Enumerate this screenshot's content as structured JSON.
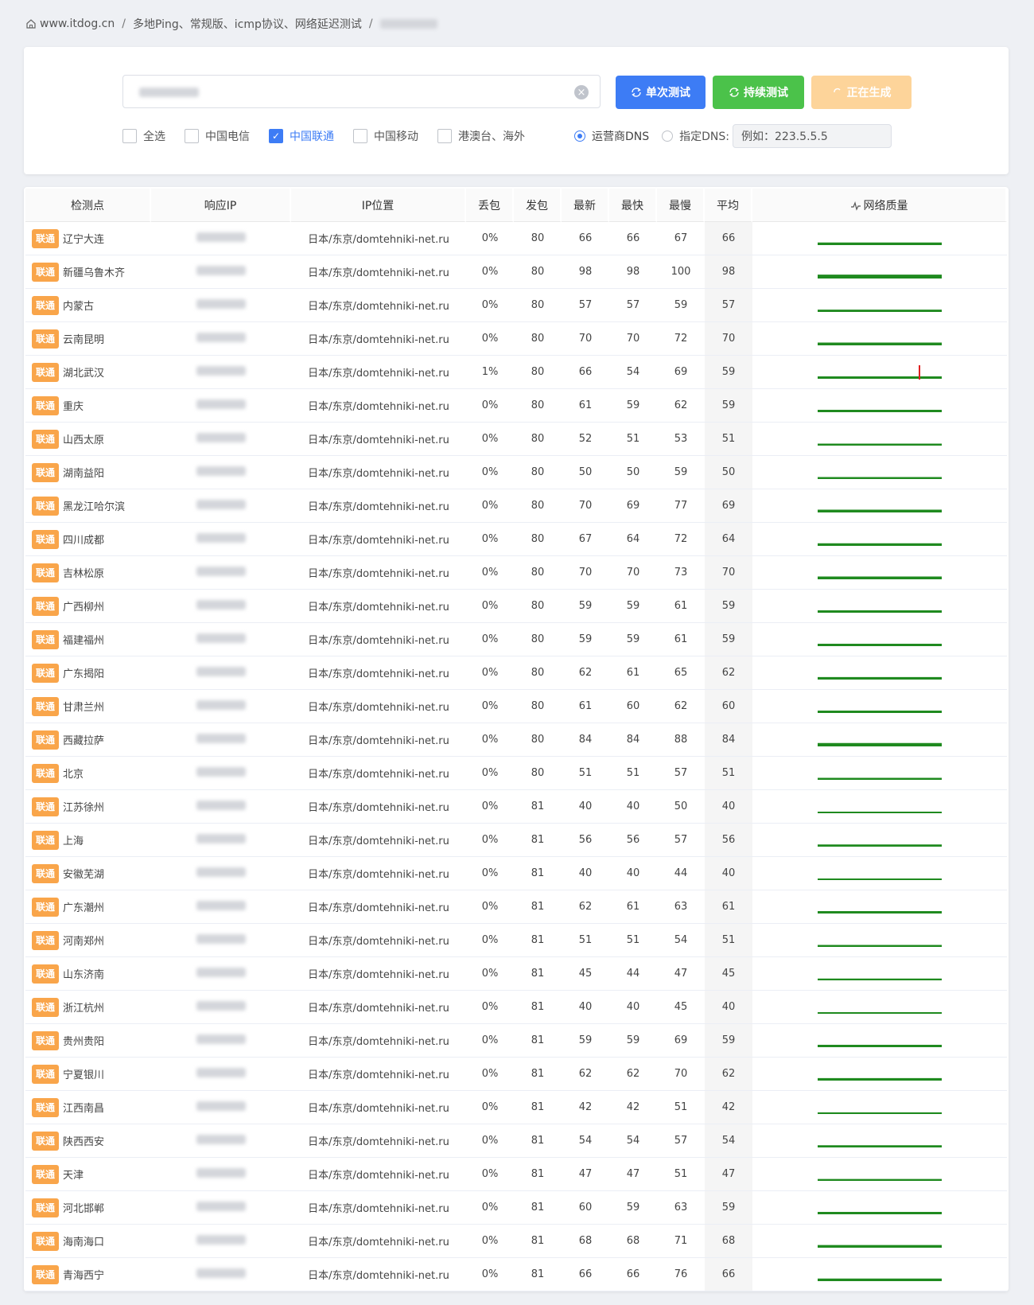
{
  "breadcrumb": {
    "home": "www.itdog.cn",
    "page": "多地Ping、常规版、icmp协议、网络延迟测试"
  },
  "search": {
    "placeholder": ""
  },
  "buttons": {
    "single": "单次测试",
    "continuous": "持续测试",
    "generating": "正在生成"
  },
  "options": {
    "select_all": "全选",
    "telecom": "中国电信",
    "unicom": "中国联通",
    "mobile": "中国移动",
    "overseas": "港澳台、海外",
    "isp_dns": "运营商DNS",
    "custom_dns": "指定DNS:",
    "dns_placeholder": "例如：223.5.5.5"
  },
  "table": {
    "headers": [
      "检测点",
      "响应IP",
      "IP位置",
      "丢包",
      "发包",
      "最新",
      "最快",
      "最慢",
      "平均",
      "网络质量"
    ],
    "rows": [
      {
        "isp": "联通",
        "node": "辽宁大连",
        "loc": "日本/东京/domtehniki-net.ru",
        "loss": "0%",
        "sent": "80",
        "latest": "66",
        "fast": "66",
        "slow": "67",
        "avg": "66"
      },
      {
        "isp": "联通",
        "node": "新疆乌鲁木齐",
        "loc": "日本/东京/domtehniki-net.ru",
        "loss": "0%",
        "sent": "80",
        "latest": "98",
        "fast": "98",
        "slow": "100",
        "avg": "98"
      },
      {
        "isp": "联通",
        "node": "内蒙古",
        "loc": "日本/东京/domtehniki-net.ru",
        "loss": "0%",
        "sent": "80",
        "latest": "57",
        "fast": "57",
        "slow": "59",
        "avg": "57"
      },
      {
        "isp": "联通",
        "node": "云南昆明",
        "loc": "日本/东京/domtehniki-net.ru",
        "loss": "0%",
        "sent": "80",
        "latest": "70",
        "fast": "70",
        "slow": "72",
        "avg": "70"
      },
      {
        "isp": "联通",
        "node": "湖北武汉",
        "loc": "日本/东京/domtehniki-net.ru",
        "loss": "1%",
        "sent": "80",
        "latest": "66",
        "fast": "54",
        "slow": "69",
        "avg": "59"
      },
      {
        "isp": "联通",
        "node": "重庆",
        "loc": "日本/东京/domtehniki-net.ru",
        "loss": "0%",
        "sent": "80",
        "latest": "61",
        "fast": "59",
        "slow": "62",
        "avg": "59"
      },
      {
        "isp": "联通",
        "node": "山西太原",
        "loc": "日本/东京/domtehniki-net.ru",
        "loss": "0%",
        "sent": "80",
        "latest": "52",
        "fast": "51",
        "slow": "53",
        "avg": "51"
      },
      {
        "isp": "联通",
        "node": "湖南益阳",
        "loc": "日本/东京/domtehniki-net.ru",
        "loss": "0%",
        "sent": "80",
        "latest": "50",
        "fast": "50",
        "slow": "59",
        "avg": "50"
      },
      {
        "isp": "联通",
        "node": "黑龙江哈尔滨",
        "loc": "日本/东京/domtehniki-net.ru",
        "loss": "0%",
        "sent": "80",
        "latest": "70",
        "fast": "69",
        "slow": "77",
        "avg": "69"
      },
      {
        "isp": "联通",
        "node": "四川成都",
        "loc": "日本/东京/domtehniki-net.ru",
        "loss": "0%",
        "sent": "80",
        "latest": "67",
        "fast": "64",
        "slow": "72",
        "avg": "64"
      },
      {
        "isp": "联通",
        "node": "吉林松原",
        "loc": "日本/东京/domtehniki-net.ru",
        "loss": "0%",
        "sent": "80",
        "latest": "70",
        "fast": "70",
        "slow": "73",
        "avg": "70"
      },
      {
        "isp": "联通",
        "node": "广西柳州",
        "loc": "日本/东京/domtehniki-net.ru",
        "loss": "0%",
        "sent": "80",
        "latest": "59",
        "fast": "59",
        "slow": "61",
        "avg": "59"
      },
      {
        "isp": "联通",
        "node": "福建福州",
        "loc": "日本/东京/domtehniki-net.ru",
        "loss": "0%",
        "sent": "80",
        "latest": "59",
        "fast": "59",
        "slow": "61",
        "avg": "59"
      },
      {
        "isp": "联通",
        "node": "广东揭阳",
        "loc": "日本/东京/domtehniki-net.ru",
        "loss": "0%",
        "sent": "80",
        "latest": "62",
        "fast": "61",
        "slow": "65",
        "avg": "62"
      },
      {
        "isp": "联通",
        "node": "甘肃兰州",
        "loc": "日本/东京/domtehniki-net.ru",
        "loss": "0%",
        "sent": "80",
        "latest": "61",
        "fast": "60",
        "slow": "62",
        "avg": "60"
      },
      {
        "isp": "联通",
        "node": "西藏拉萨",
        "loc": "日本/东京/domtehniki-net.ru",
        "loss": "0%",
        "sent": "80",
        "latest": "84",
        "fast": "84",
        "slow": "88",
        "avg": "84"
      },
      {
        "isp": "联通",
        "node": "北京",
        "loc": "日本/东京/domtehniki-net.ru",
        "loss": "0%",
        "sent": "80",
        "latest": "51",
        "fast": "51",
        "slow": "57",
        "avg": "51"
      },
      {
        "isp": "联通",
        "node": "江苏徐州",
        "loc": "日本/东京/domtehniki-net.ru",
        "loss": "0%",
        "sent": "81",
        "latest": "40",
        "fast": "40",
        "slow": "50",
        "avg": "40"
      },
      {
        "isp": "联通",
        "node": "上海",
        "loc": "日本/东京/domtehniki-net.ru",
        "loss": "0%",
        "sent": "81",
        "latest": "56",
        "fast": "56",
        "slow": "57",
        "avg": "56"
      },
      {
        "isp": "联通",
        "node": "安徽芜湖",
        "loc": "日本/东京/domtehniki-net.ru",
        "loss": "0%",
        "sent": "81",
        "latest": "40",
        "fast": "40",
        "slow": "44",
        "avg": "40"
      },
      {
        "isp": "联通",
        "node": "广东潮州",
        "loc": "日本/东京/domtehniki-net.ru",
        "loss": "0%",
        "sent": "81",
        "latest": "62",
        "fast": "61",
        "slow": "63",
        "avg": "61"
      },
      {
        "isp": "联通",
        "node": "河南郑州",
        "loc": "日本/东京/domtehniki-net.ru",
        "loss": "0%",
        "sent": "81",
        "latest": "51",
        "fast": "51",
        "slow": "54",
        "avg": "51"
      },
      {
        "isp": "联通",
        "node": "山东济南",
        "loc": "日本/东京/domtehniki-net.ru",
        "loss": "0%",
        "sent": "81",
        "latest": "45",
        "fast": "44",
        "slow": "47",
        "avg": "45"
      },
      {
        "isp": "联通",
        "node": "浙江杭州",
        "loc": "日本/东京/domtehniki-net.ru",
        "loss": "0%",
        "sent": "81",
        "latest": "40",
        "fast": "40",
        "slow": "45",
        "avg": "40"
      },
      {
        "isp": "联通",
        "node": "贵州贵阳",
        "loc": "日本/东京/domtehniki-net.ru",
        "loss": "0%",
        "sent": "81",
        "latest": "59",
        "fast": "59",
        "slow": "69",
        "avg": "59"
      },
      {
        "isp": "联通",
        "node": "宁夏银川",
        "loc": "日本/东京/domtehniki-net.ru",
        "loss": "0%",
        "sent": "81",
        "latest": "62",
        "fast": "62",
        "slow": "70",
        "avg": "62"
      },
      {
        "isp": "联通",
        "node": "江西南昌",
        "loc": "日本/东京/domtehniki-net.ru",
        "loss": "0%",
        "sent": "81",
        "latest": "42",
        "fast": "42",
        "slow": "51",
        "avg": "42"
      },
      {
        "isp": "联通",
        "node": "陕西西安",
        "loc": "日本/东京/domtehniki-net.ru",
        "loss": "0%",
        "sent": "81",
        "latest": "54",
        "fast": "54",
        "slow": "57",
        "avg": "54"
      },
      {
        "isp": "联通",
        "node": "天津",
        "loc": "日本/东京/domtehniki-net.ru",
        "loss": "0%",
        "sent": "81",
        "latest": "47",
        "fast": "47",
        "slow": "51",
        "avg": "47"
      },
      {
        "isp": "联通",
        "node": "河北邯郸",
        "loc": "日本/东京/domtehniki-net.ru",
        "loss": "0%",
        "sent": "81",
        "latest": "60",
        "fast": "59",
        "slow": "63",
        "avg": "59"
      },
      {
        "isp": "联通",
        "node": "海南海口",
        "loc": "日本/东京/domtehniki-net.ru",
        "loss": "0%",
        "sent": "81",
        "latest": "68",
        "fast": "68",
        "slow": "71",
        "avg": "68"
      },
      {
        "isp": "联通",
        "node": "青海西宁",
        "loc": "日本/东京/domtehniki-net.ru",
        "loss": "0%",
        "sent": "81",
        "latest": "66",
        "fast": "66",
        "slow": "76",
        "avg": "66"
      }
    ]
  },
  "colors": {
    "primary": "#3d7cf5",
    "success": "#4bc24a",
    "warning_light": "#fdd49a",
    "tag": "#f9a54a",
    "quality_line": "#1f8a1f",
    "quality_spike": "#e02020"
  },
  "icons": [
    "home-icon",
    "clear-icon",
    "refresh-icon",
    "loading-icon",
    "check-icon",
    "pulse-icon"
  ]
}
